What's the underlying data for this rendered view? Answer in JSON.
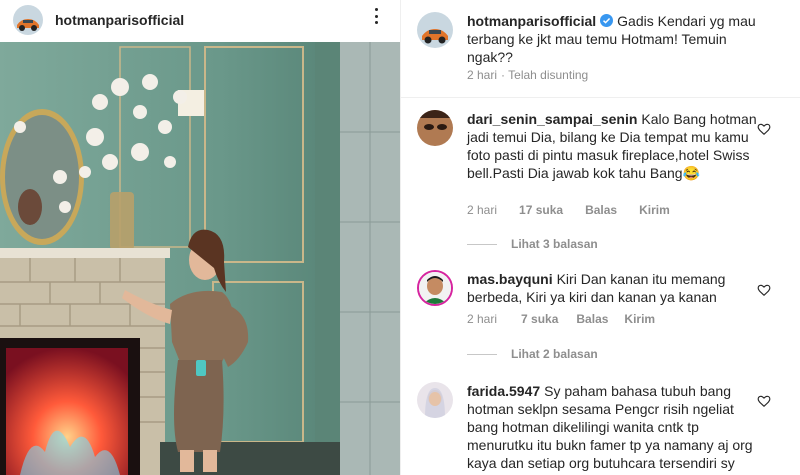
{
  "post": {
    "username": "hotmanparisofficial"
  },
  "caption": {
    "username": "hotmanparisofficial",
    "text": "Gadis Kendari yg mau terbang ke jkt mau temu Hotmam! Temuin ngak??",
    "time": "2 hari",
    "edited": "· Telah disunting"
  },
  "comments": [
    {
      "username": "dari_senin_sampai_senin",
      "text": "Kalo Bang hotman jadi temui Dia, bilang ke Dia tempat mu kamu foto pasti di pintu masuk fireplace,hotel Swiss bell.Pasti Dia jawab kok tahu Bang😂",
      "time": "2 hari",
      "likes": "17 suka",
      "reply": "Balas",
      "send": "Kirim",
      "view_replies": "Lihat 3 balasan"
    },
    {
      "username": "mas.bayquni",
      "text": "Kiri Dan kanan itu memang berbeda, Kiri ya kiri dan kanan ya kanan",
      "time": "2 hari",
      "likes": "7 suka",
      "reply": "Balas",
      "send": "Kirim",
      "view_replies": "Lihat 2 balasan"
    },
    {
      "username": "farida.5947",
      "text": "Sy paham bahasa tubuh bang hotman seklpn sesama Pengcr risih ngeliat bang hotman dikelilingi wanita cntk tp menurutku itu bukn famer tp ya namany aj org kaya dan setiap org butuhcara tersendiri sy setuju bang hotman puny hobrn sopri"
    }
  ],
  "colors": {
    "text": "#262626",
    "secondary": "#8e8e8e",
    "verified": "#3897f0",
    "divider": "#efefef",
    "wall": "#6f9c8e"
  }
}
